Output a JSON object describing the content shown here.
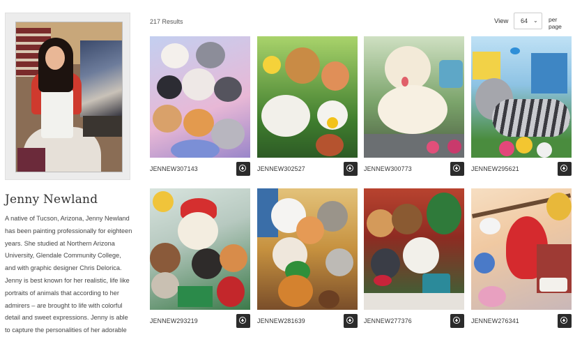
{
  "results": {
    "count_label": "217 Results"
  },
  "view": {
    "label": "View",
    "selected": "64",
    "per_page_label": "per page"
  },
  "artist": {
    "name": "Jenny Newland",
    "bio": "A native of Tucson, Arizona, Jenny Newland has been painting professionally for eighteen years. She studied at Northern Arizona University, Glendale Community College, and with graphic designer Chris Delorica. Jenny is best known for her realistic, life like portraits of animals that according to her admirers – are brought to life with colorful detail and sweet expressions. Jenny is able to capture the personalities of her adorable"
  },
  "products": [
    {
      "sku": "JENNEW307143",
      "subject": "kittens",
      "bg": "#b9c6e6"
    },
    {
      "sku": "JENNEW302527",
      "subject": "puppies-garden",
      "bg": "#6fa84a"
    },
    {
      "sku": "JENNEW300773",
      "subject": "golden-puppy",
      "bg": "#7aa36a"
    },
    {
      "sku": "JENNEW295621",
      "subject": "tabby-cat",
      "bg": "#a6cfe9"
    },
    {
      "sku": "JENNEW293219",
      "subject": "christmas-puppies",
      "bg": "#c8d7cf"
    },
    {
      "sku": "JENNEW281639",
      "subject": "christmas-kittens",
      "bg": "#d6a95a"
    },
    {
      "sku": "JENNEW277376",
      "subject": "christmas-dogs",
      "bg": "#c54a3a"
    },
    {
      "sku": "JENNEW276341",
      "subject": "birds",
      "bg": "#f1c9a8"
    }
  ],
  "icons": {
    "add": "plus-circle-icon",
    "dropdown": "chevron-down-icon"
  }
}
